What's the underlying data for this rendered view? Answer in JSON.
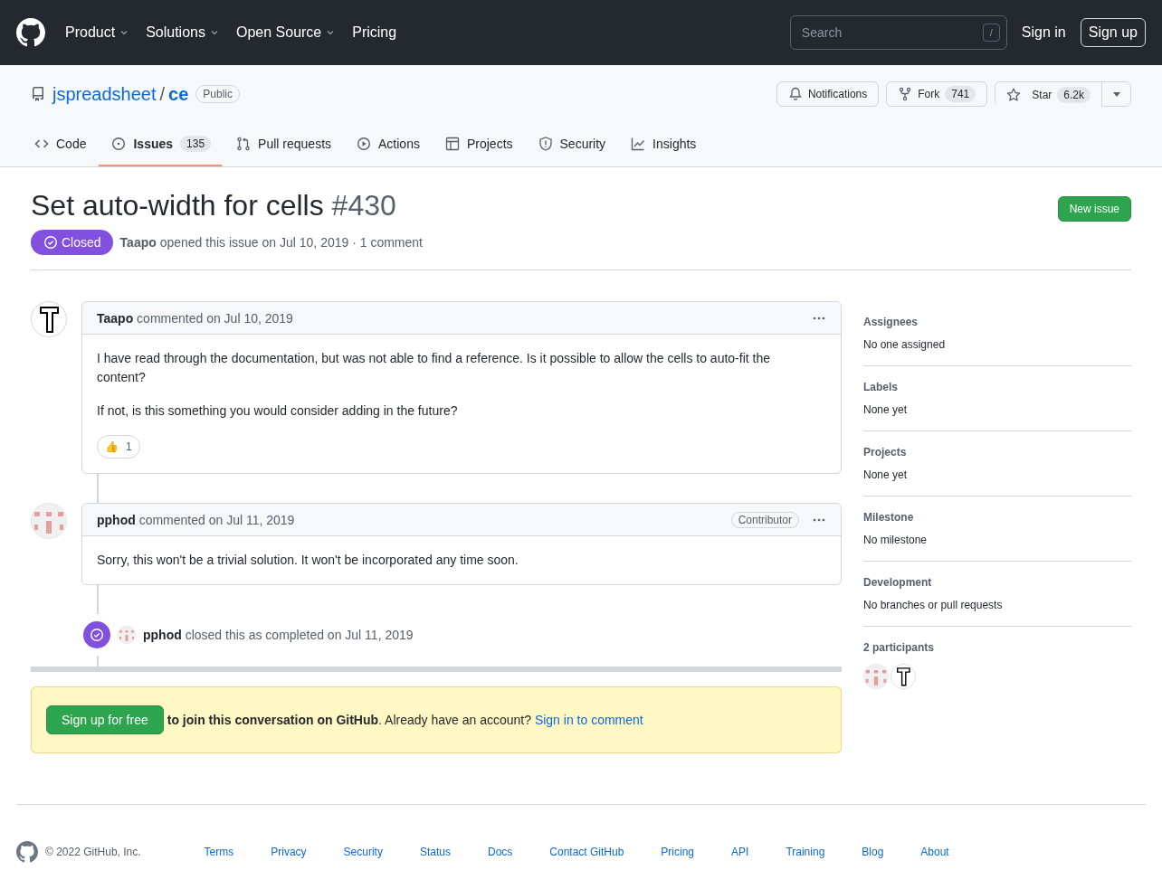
{
  "header": {
    "nav": [
      {
        "label": "Product",
        "dropdown": true
      },
      {
        "label": "Solutions",
        "dropdown": true
      },
      {
        "label": "Open Source",
        "dropdown": true
      },
      {
        "label": "Pricing",
        "dropdown": false
      }
    ],
    "search": {
      "placeholder": "Search",
      "shortcut": "/"
    },
    "sign_in": "Sign in",
    "sign_up": "Sign up"
  },
  "repo": {
    "owner": "jspreadsheet",
    "separator": "/",
    "name": "ce",
    "visibility": "Public",
    "notifications": "Notifications",
    "fork": {
      "label": "Fork",
      "count": "741"
    },
    "star": {
      "label": "Star",
      "count": "6.2k"
    }
  },
  "tabs": [
    {
      "kind": "code",
      "label": "Code",
      "selected": false
    },
    {
      "kind": "issues",
      "label": "Issues",
      "count": "135",
      "selected": true
    },
    {
      "kind": "pulls",
      "label": "Pull requests",
      "selected": false
    },
    {
      "kind": "actions",
      "label": "Actions",
      "selected": false
    },
    {
      "kind": "projects",
      "label": "Projects",
      "selected": false
    },
    {
      "kind": "security",
      "label": "Security",
      "selected": false
    },
    {
      "kind": "insights",
      "label": "Insights",
      "selected": false
    }
  ],
  "issue": {
    "title": "Set auto-width for cells",
    "number": "#430",
    "closed": true,
    "state_label": "Closed",
    "author": "Taapo",
    "meta": "opened this issue on Jul 10, 2019 · 1 comment",
    "new_issue": "New issue"
  },
  "timeline": [
    {
      "kind": "comment",
      "avatar": {
        "kind": "letter-t"
      },
      "author": "Taapo",
      "meta": "commented on Jul 10, 2019",
      "paragraphs": [
        "I have read through the documentation, but was not able to find a reference. Is it possible to allow the cells to auto-fit the content?",
        "If not, is this something you would consider adding in the future?"
      ],
      "reactions": [
        {
          "emoji": "👍",
          "count": "1"
        }
      ]
    },
    {
      "kind": "comment",
      "avatar": {
        "kind": "identicon"
      },
      "author": "pphod",
      "meta": "commented on Jul 11, 2019",
      "badge": "Contributor",
      "paragraphs": [
        "Sorry, this won't be a trivial solution. It won't be incorporated any time soon."
      ]
    },
    {
      "kind": "event",
      "avatar": {
        "kind": "identicon"
      },
      "actor": "pphod",
      "text": "closed this as completed on Jul 11, 2019"
    }
  ],
  "signup": {
    "button": "Sign up for free",
    "text": "**to join this conversation on GitHub**. Already have an account?",
    "link": "Sign in to comment"
  },
  "sidebar": {
    "sections": [
      {
        "heading": "Assignees",
        "value": "No one assigned"
      },
      {
        "heading": "Labels",
        "value": "None yet"
      },
      {
        "heading": "Projects",
        "value": "None yet"
      },
      {
        "heading": "Milestone",
        "value": "No milestone"
      },
      {
        "heading": "Development",
        "value": "No branches or pull requests"
      }
    ],
    "participants": {
      "heading": "2 participants",
      "avatars": [
        {
          "kind": "identicon"
        },
        {
          "kind": "letter-t"
        }
      ]
    }
  },
  "footer": {
    "copyright": "© 2022 GitHub, Inc.",
    "links": [
      "Terms",
      "Privacy",
      "Security",
      "Status",
      "Docs",
      "Contact GitHub",
      "Pricing",
      "API",
      "Training",
      "Blog",
      "About"
    ]
  }
}
